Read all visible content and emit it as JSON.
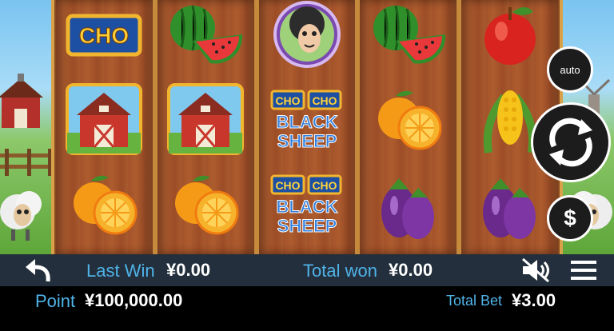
{
  "bottom_bar": {
    "last_win_label": "Last Win",
    "last_win_value": "¥0.00",
    "total_won_label": "Total won",
    "total_won_value": "¥0.00",
    "point_label": "Point",
    "point_value": "¥100,000.00",
    "total_bet_label": "Total Bet",
    "total_bet_value": "¥3.00"
  },
  "controls": {
    "auto_label": "auto",
    "bet_symbol": "$"
  },
  "symbols": {
    "cho_logo": "CHO",
    "cho_cho": "CHO",
    "black_sheep_line1": "BLACK",
    "black_sheep_line2": "SHEEP"
  },
  "reels": [
    [
      "cho-logo",
      "barn",
      "orange"
    ],
    [
      "watermelon",
      "barn",
      "orange"
    ],
    [
      "black-sheep",
      "cho-cho-black-sheep",
      "cho-cho-black-sheep"
    ],
    [
      "watermelon",
      "orange",
      "eggplant"
    ],
    [
      "apple",
      "corn",
      "eggplant"
    ]
  ],
  "colors": {
    "label_blue": "#4fb3e8",
    "bar_dark": "#232f3c",
    "wood": "#a4532a"
  }
}
